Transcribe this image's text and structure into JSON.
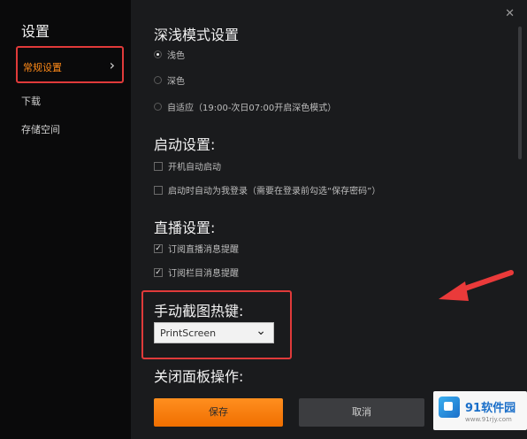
{
  "sidebar": {
    "title": "设置",
    "items": [
      {
        "label": "常规设置",
        "active": true
      },
      {
        "label": "下载"
      },
      {
        "label": "存储空间"
      }
    ]
  },
  "theme": {
    "title": "深浅模式设置",
    "options": [
      {
        "label": "浅色",
        "selected": true
      },
      {
        "label": "深色"
      },
      {
        "label": "自适应（19:00-次日07:00开启深色模式）"
      }
    ]
  },
  "startup": {
    "title": "启动设置:",
    "options": [
      {
        "label": "开机自动启动",
        "checked": false
      },
      {
        "label": "启动时自动为我登录（需要在登录前勾选“保存密码”）",
        "checked": false
      }
    ]
  },
  "live": {
    "title": "直播设置:",
    "options": [
      {
        "label": "订阅直播消息提醒",
        "checked": true
      },
      {
        "label": "订阅栏目消息提醒",
        "checked": true
      }
    ]
  },
  "hotkey": {
    "title": "手动截图热键:",
    "selected": "PrintScreen"
  },
  "close_panel": {
    "title": "关闭面板操作:"
  },
  "buttons": {
    "save": "保存",
    "cancel": "取消"
  },
  "watermark": {
    "brand": "91软件园",
    "url": "www.91rjy.com"
  },
  "colors": {
    "accent": "#ff8a18",
    "highlight_border": "#e03a3a",
    "arrow": "#ea3a3a"
  }
}
